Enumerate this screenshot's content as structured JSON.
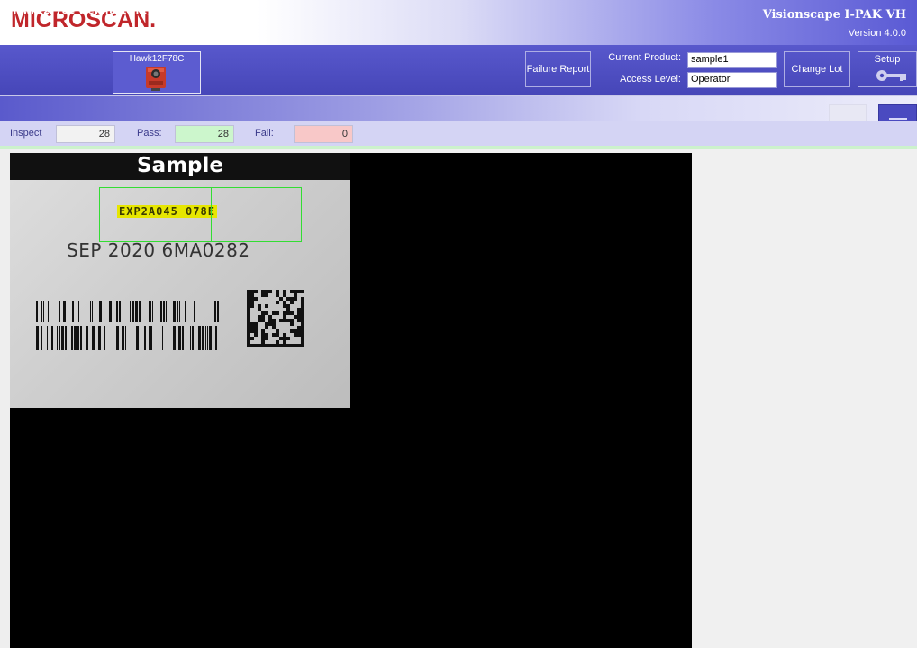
{
  "header": {
    "logo_text": "MICROSCAN.",
    "product_name": "Visionscape I-PAK VH",
    "version": "Version 4.0.0"
  },
  "toolbar": {
    "camera_name": "Hawk12F78C",
    "failure_report_label": "Failure Report",
    "current_product_label": "Current Product:",
    "current_product_value": "sample1",
    "access_level_label": "Access Level:",
    "access_level_value": "Operator",
    "change_lot_label": "Change Lot",
    "setup_label": "Setup"
  },
  "view": {
    "title": "Hawk12F78C  View [auto fit]"
  },
  "stats": {
    "inspect_label": "Inspect",
    "inspect_value": "28",
    "pass_label": "Pass:",
    "pass_value": "28",
    "fail_label": "Fail:",
    "fail_value": "0"
  },
  "image": {
    "banner_text": "Sample",
    "ocr_result": "EXP2A045 078E",
    "date_line": "SEP 2020   6MA0282"
  },
  "icons": {
    "camera": "camera-icon",
    "key": "key-icon",
    "dropdown": "triangle-down-icon"
  },
  "colors": {
    "brand_red": "#c0262b",
    "toolbar_blue": "#4a4abc",
    "pass_green": "#ccf6cc",
    "fail_red": "#f8c8c8",
    "roi_green": "#33dd33",
    "ocr_highlight": "#e6e600"
  }
}
